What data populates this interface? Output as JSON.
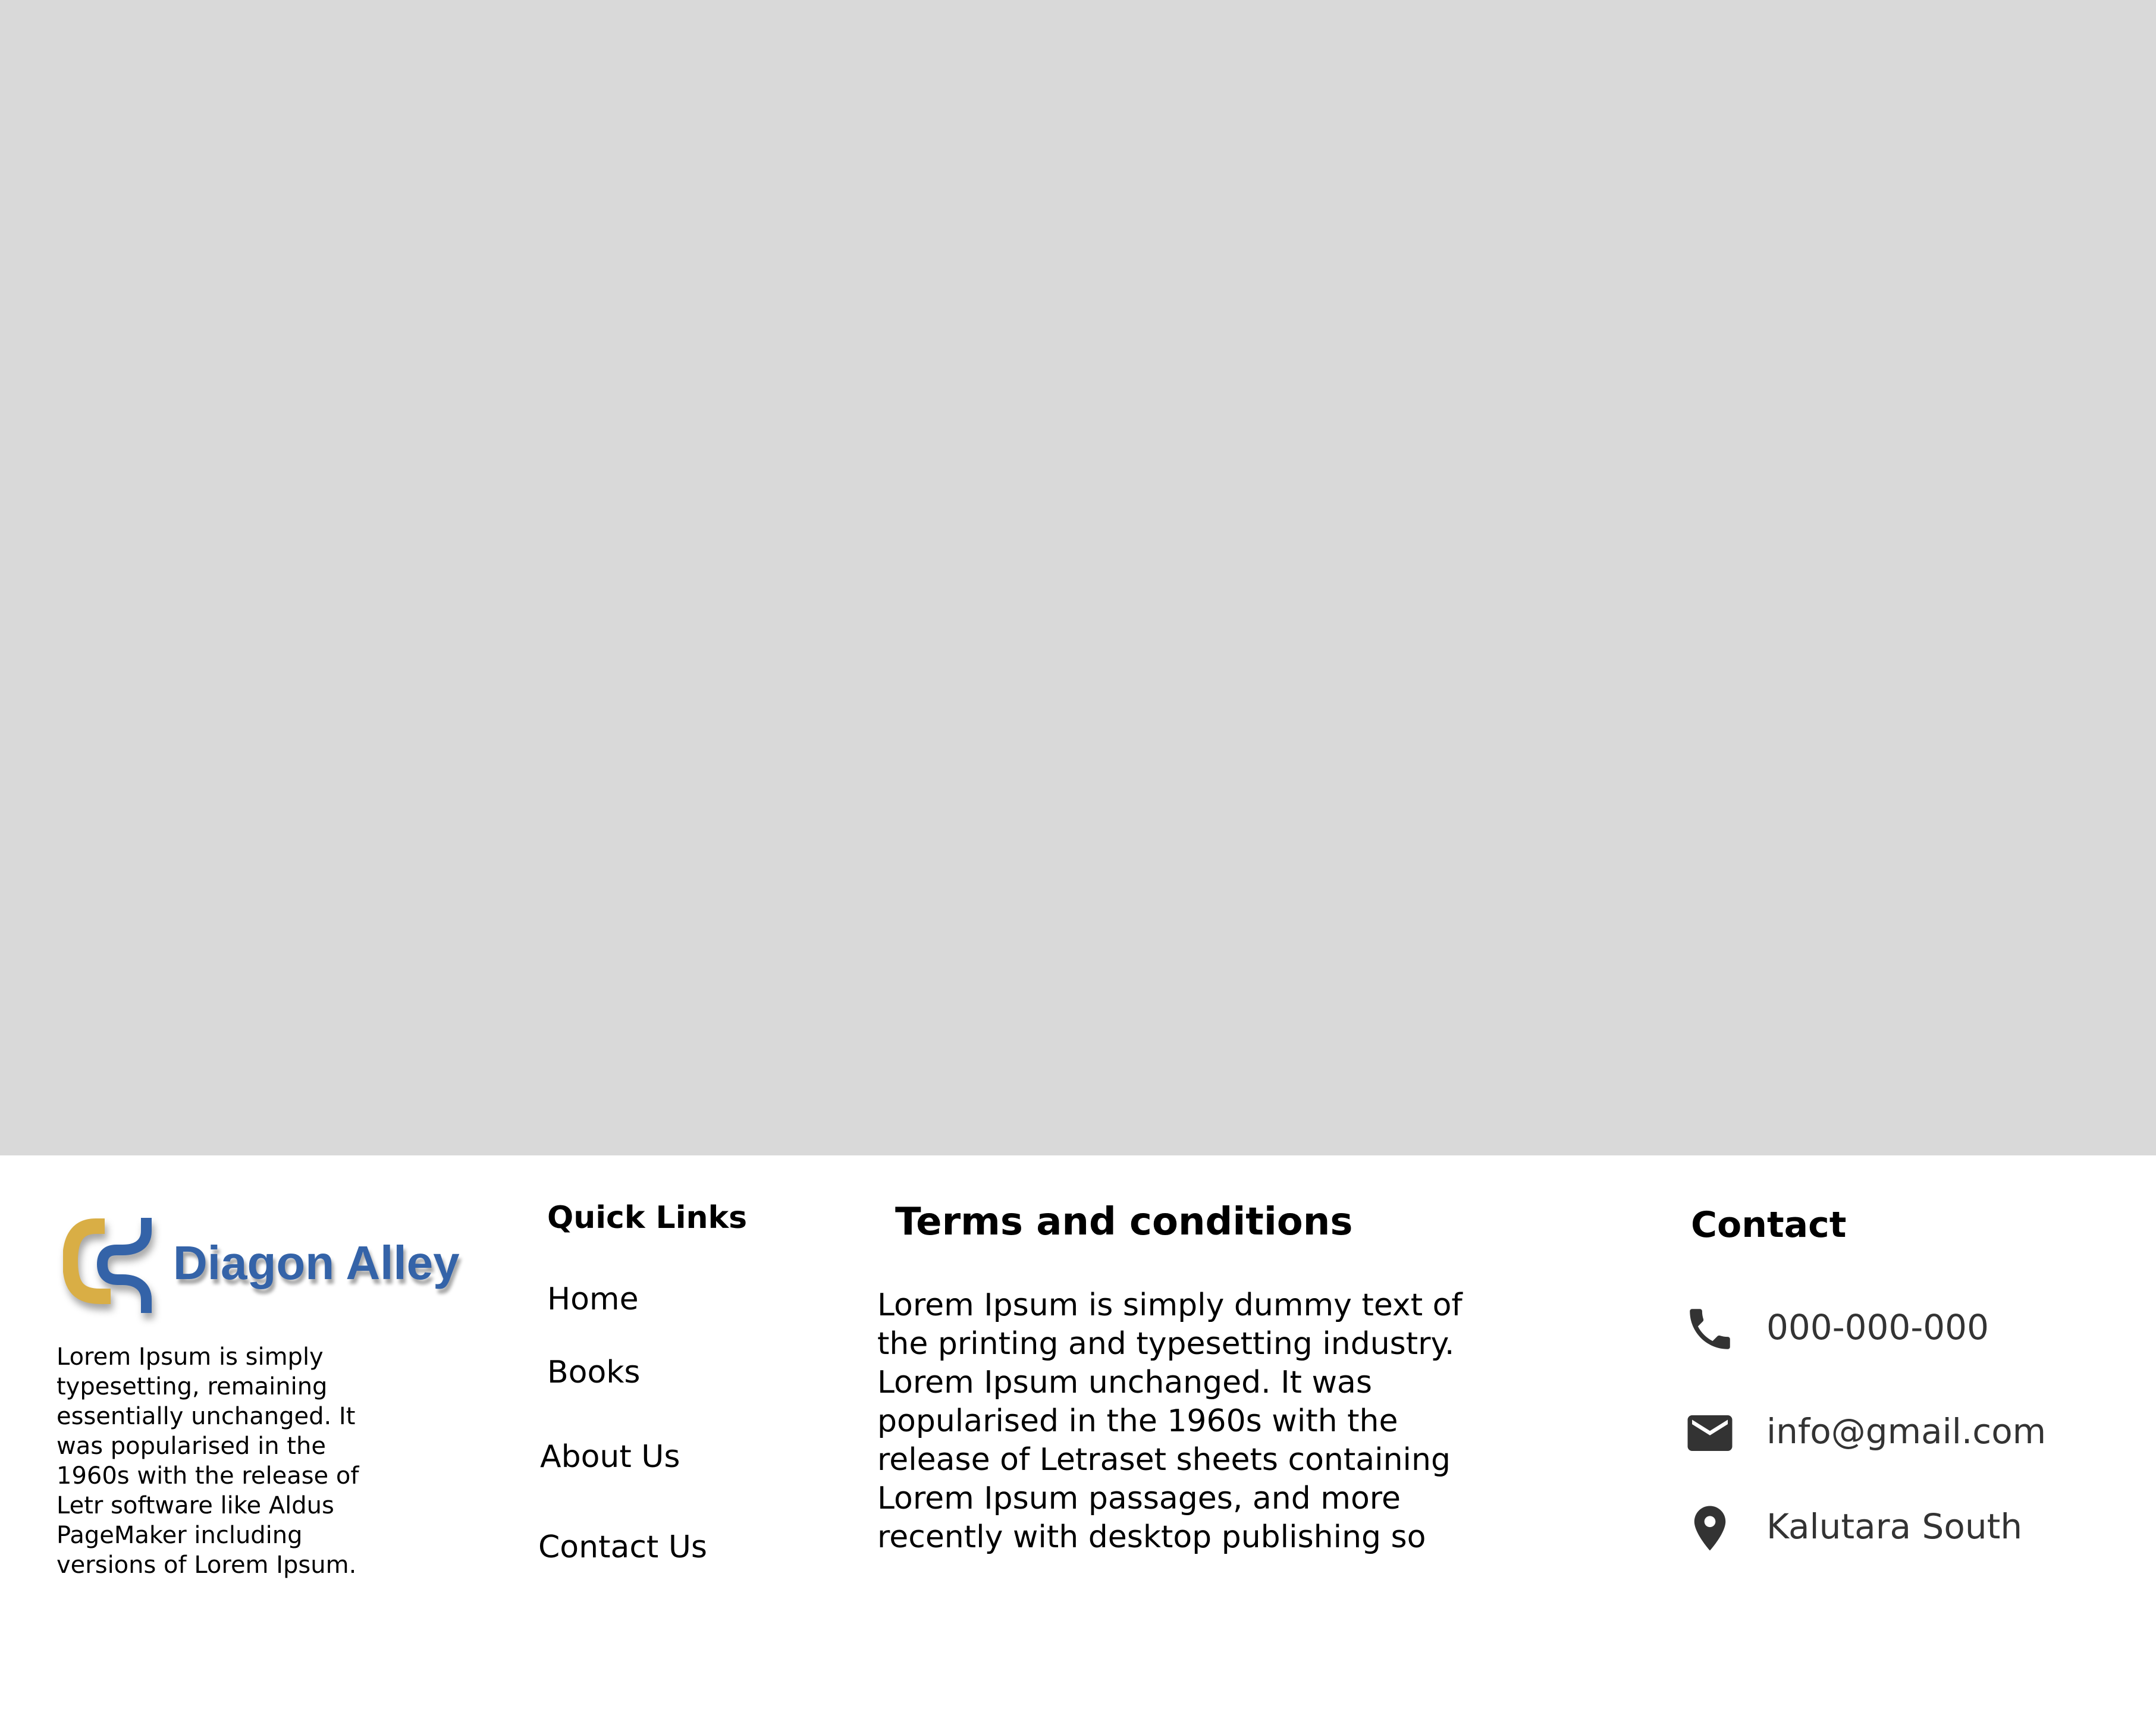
{
  "brand": {
    "name": "Diagon Alley",
    "colors": {
      "primary": "#3463a8",
      "accent": "#d9ae45"
    },
    "description_lines": [
      "Lorem Ipsum is simply",
      "typesetting, remaining",
      "essentially unchanged. It",
      "was popularised in the",
      "1960s with the release of",
      "Letr software like Aldus",
      "PageMaker including",
      "versions of Lorem Ipsum."
    ]
  },
  "quick_links": {
    "title": "Quick Links",
    "items": [
      {
        "label": "Home"
      },
      {
        "label": "Books"
      },
      {
        "label": "About Us"
      },
      {
        "label": "Contact Us"
      }
    ]
  },
  "terms": {
    "title": "Terms and conditions",
    "lines": [
      "Lorem Ipsum is simply dummy text of",
      "the printing and typesetting industry.",
      "Lorem Ipsum  unchanged. It was",
      "popularised in the 1960s with the",
      "release of Letraset sheets containing",
      "Lorem Ipsum passages, and more",
      "recently with desktop publishing so"
    ]
  },
  "contact": {
    "title": "Contact",
    "phone": {
      "icon": "phone-icon",
      "value": "000-000-000"
    },
    "email": {
      "icon": "mail-icon",
      "value": "info@gmail.com"
    },
    "location": {
      "icon": "location-pin-icon",
      "value": "Kalutara South"
    }
  },
  "hero": {
    "background": "#d9d9d9"
  }
}
